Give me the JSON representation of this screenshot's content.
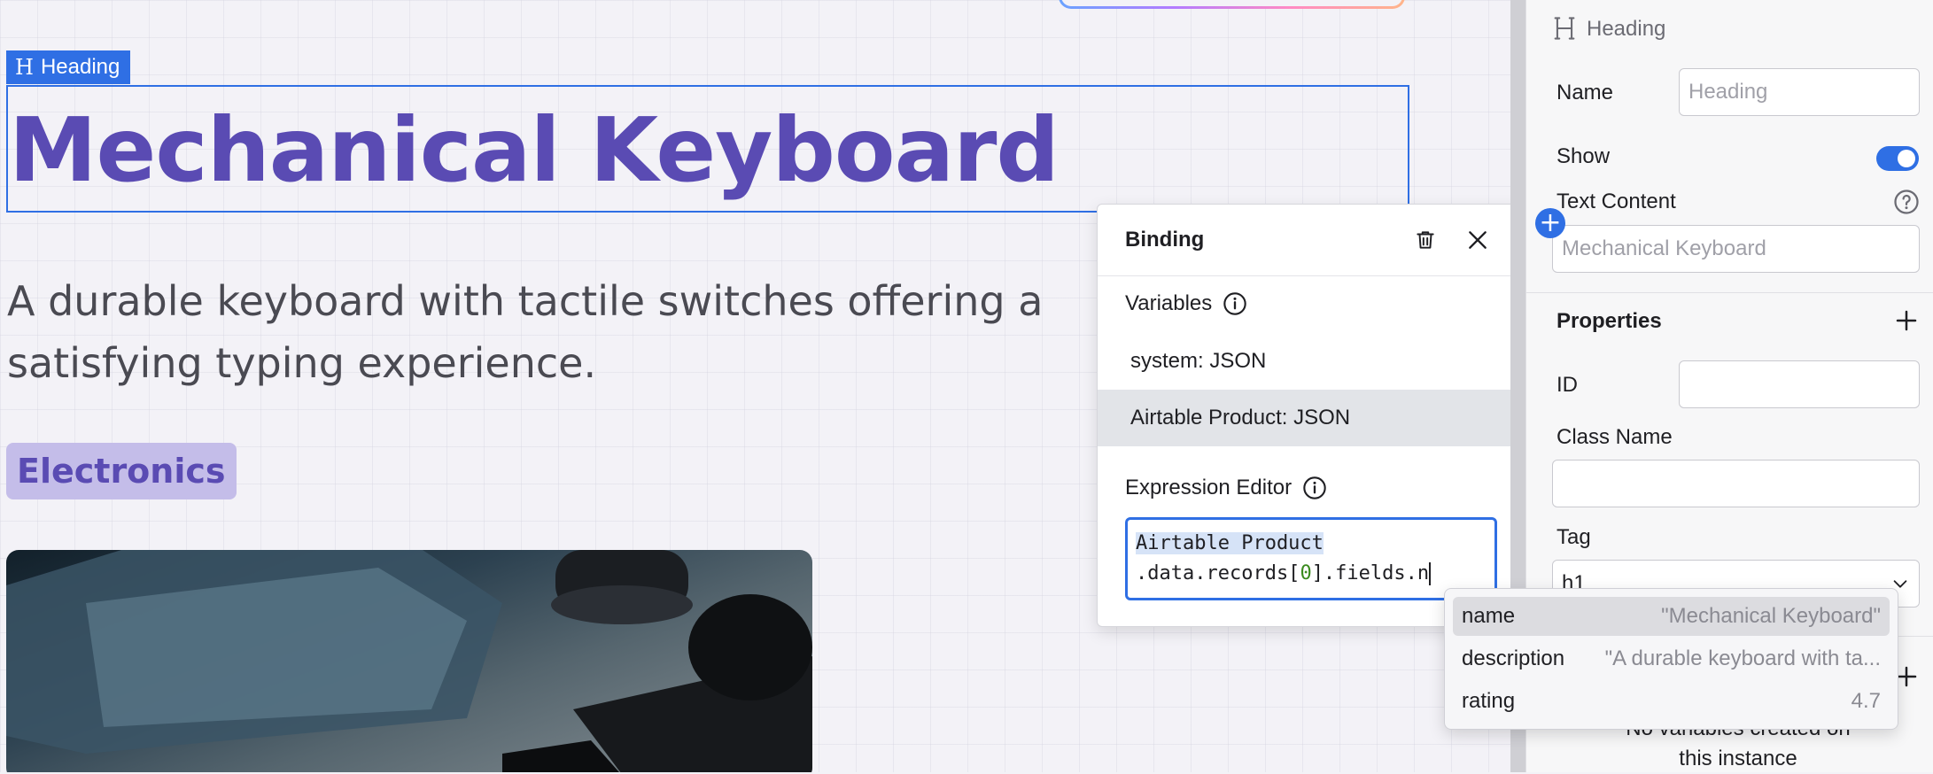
{
  "canvas": {
    "selection_badge": {
      "icon": "H",
      "label": "Heading"
    },
    "heading": "Mechanical Keyboard",
    "description": "A durable keyboard with tactile switches offering a satisfying typing experience.",
    "category_tag": "Electronics",
    "colors": {
      "heading": "#5a4bb3",
      "tag_bg": "#c4bde9",
      "selection": "#2f6fe4"
    }
  },
  "binding_popup": {
    "title": "Binding",
    "variables_label": "Variables",
    "variables": [
      "system: JSON",
      "Airtable Product: JSON"
    ],
    "selected_variable": "Airtable Product: JSON",
    "expression_label": "Expression Editor",
    "expression": {
      "var_name": "Airtable Product",
      "line2_prefix": ".data.records[",
      "index": "0",
      "line2_suffix": "].fields.n"
    }
  },
  "autocomplete": [
    {
      "key": "name",
      "value": "\"Mechanical Keyboard\""
    },
    {
      "key": "description",
      "value": "\"A durable keyboard with ta..."
    },
    {
      "key": "rating",
      "value": "4.7"
    }
  ],
  "panel": {
    "title_icon": "H",
    "title": "Heading",
    "name_label": "Name",
    "name_placeholder": "Heading",
    "show_label": "Show",
    "show_enabled": true,
    "text_content_label": "Text Content",
    "text_content_placeholder": "Mechanical Keyboard",
    "properties_title": "Properties",
    "id_label": "ID",
    "id_value": "",
    "class_name_label": "Class Name",
    "class_name_value": "",
    "tag_label": "Tag",
    "tag_value": "h1",
    "variables_empty_text": "No variables created on this instance"
  }
}
